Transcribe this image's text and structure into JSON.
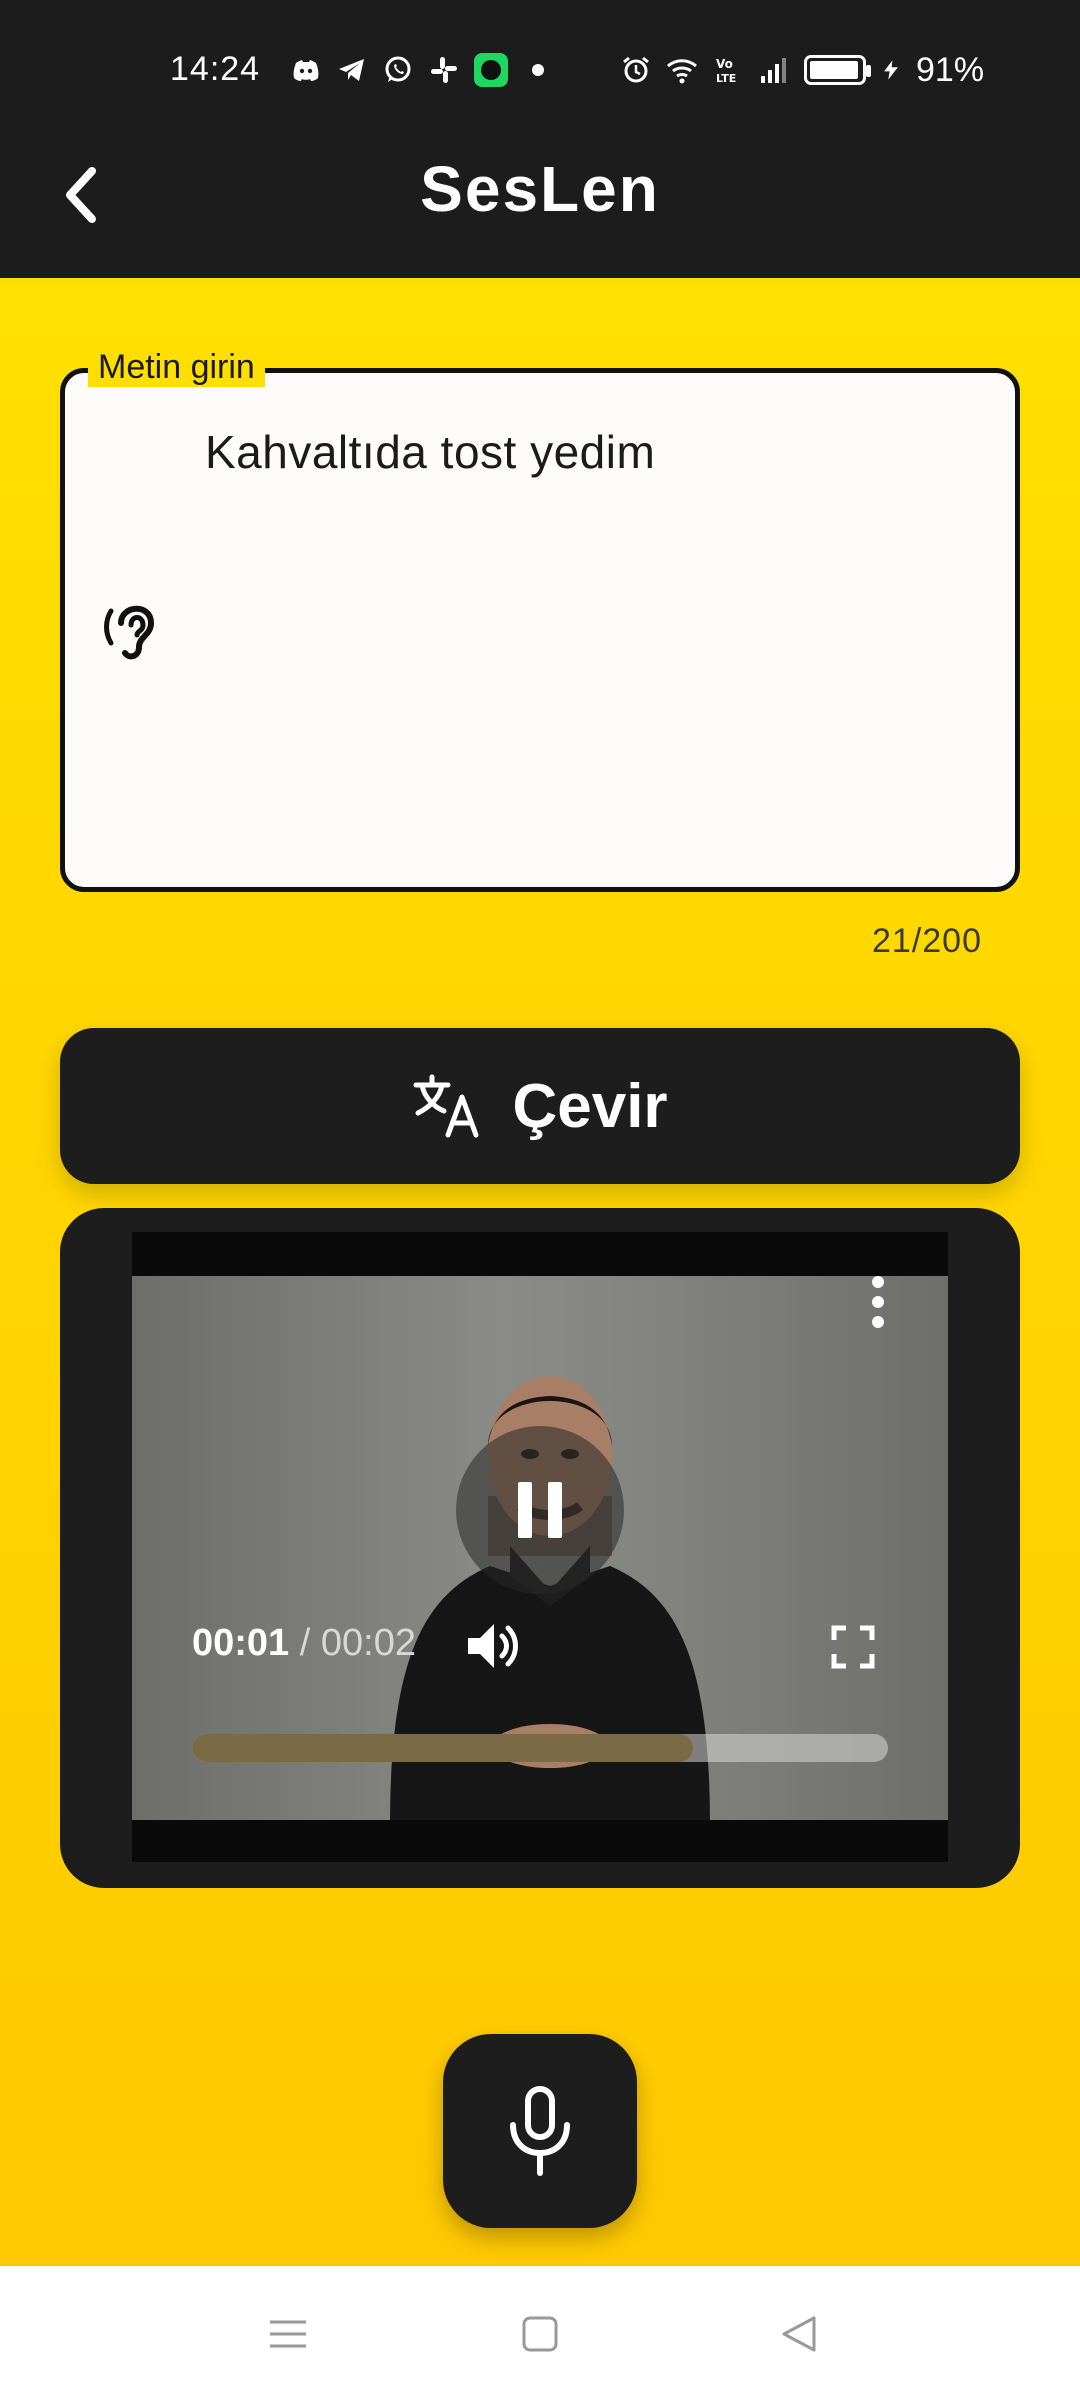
{
  "status_bar": {
    "time": "14:24",
    "battery_percent": "91%",
    "notification_icons": [
      "discord-icon",
      "telegram-icon",
      "whatsapp-icon",
      "slack-icon",
      "spotify-icon"
    ],
    "system_icons": [
      "alarm-icon",
      "wifi-icon",
      "volte-icon",
      "signal-icon",
      "battery-icon",
      "charging-icon"
    ]
  },
  "header": {
    "title": "SesLen",
    "back_icon": "chevron-left-icon"
  },
  "input": {
    "label": "Metin girin",
    "value": "Kahvaltıda tost yedim",
    "counter": "21/200",
    "icon": "hearing-icon"
  },
  "translate_button": {
    "label": "Çevir",
    "icon": "translate-icon"
  },
  "video_player": {
    "current_time": "00:01",
    "separator": " / ",
    "total_time": "00:02",
    "progress": 0.72,
    "state": "playing",
    "icons": [
      "pause-icon",
      "more-vert-icon",
      "volume-icon",
      "fullscreen-icon"
    ]
  },
  "mic_button": {
    "icon": "mic-icon"
  },
  "nav_bar": {
    "items": [
      "menu-icon",
      "home-icon",
      "back-icon"
    ]
  },
  "colors": {
    "accent_yellow": "#FFD900",
    "dark": "#1D1D1D",
    "progress_fill": "#7B6A46"
  }
}
